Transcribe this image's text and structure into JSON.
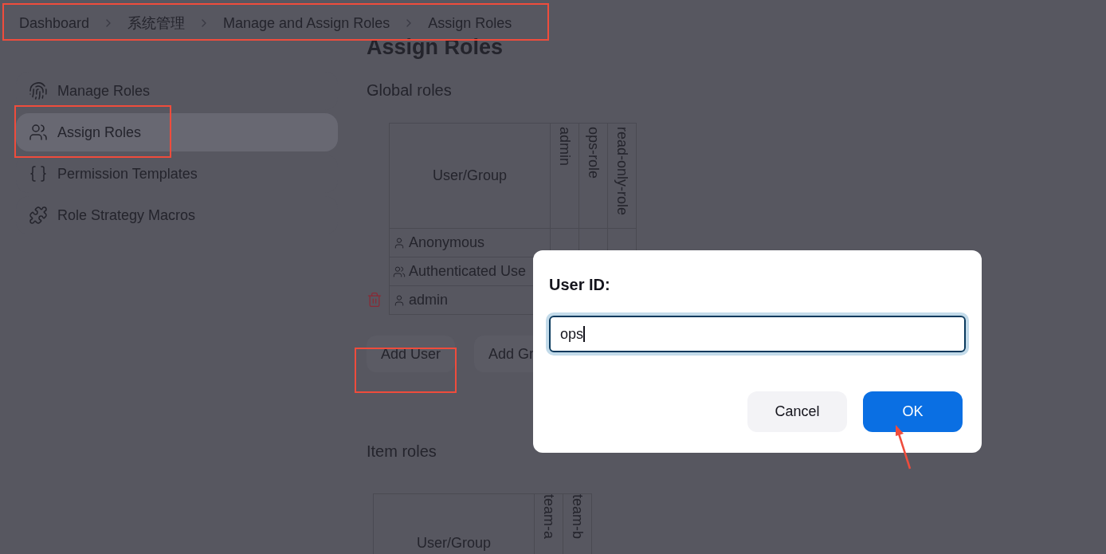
{
  "breadcrumb": [
    "Dashboard",
    "系统管理",
    "Manage and Assign Roles",
    "Assign Roles"
  ],
  "page_title": "Assign Roles",
  "sidebar": {
    "items": [
      {
        "label": "Manage Roles",
        "selected": false
      },
      {
        "label": "Assign Roles",
        "selected": true
      },
      {
        "label": "Permission Templates",
        "selected": false
      },
      {
        "label": "Role Strategy Macros",
        "selected": false
      }
    ]
  },
  "global_roles": {
    "title": "Global roles",
    "columns": [
      "User/Group",
      "admin",
      "ops-role",
      "read-only-role"
    ],
    "rows": [
      {
        "name": "Anonymous",
        "kind": "user",
        "deletable": false
      },
      {
        "name": "Authenticated Use",
        "kind": "group",
        "deletable": false
      },
      {
        "name": "admin",
        "kind": "user",
        "deletable": true
      }
    ],
    "buttons": [
      "Add User",
      "Add Gr"
    ]
  },
  "item_roles": {
    "title": "Item roles",
    "columns": [
      "User/Group",
      "team-a",
      "team-b"
    ]
  },
  "dialog": {
    "label": "User ID:",
    "value": "ops",
    "buttons": [
      {
        "label": "Cancel",
        "primary": false
      },
      {
        "label": "OK",
        "primary": true
      }
    ]
  }
}
